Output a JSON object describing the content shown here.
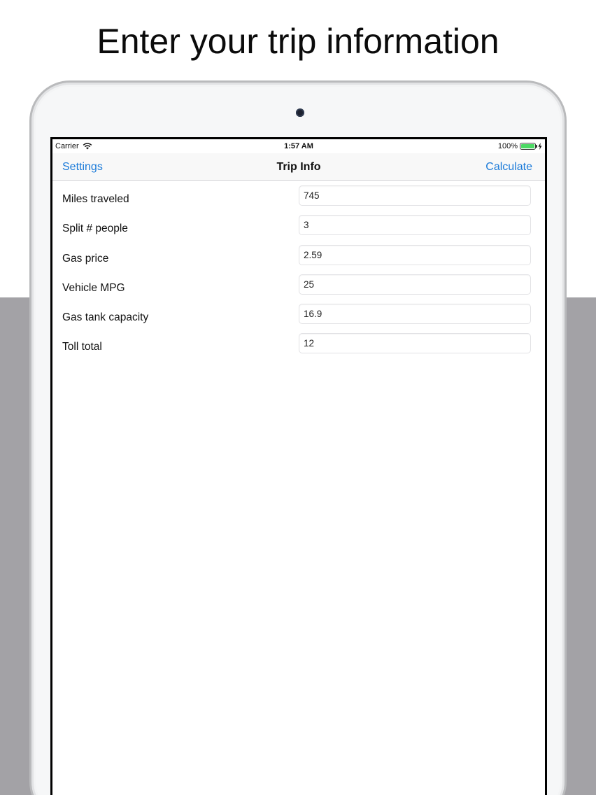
{
  "headline": "Enter your trip information",
  "status_bar": {
    "carrier": "Carrier",
    "time": "1:57 AM",
    "battery": "100%",
    "battery_level": 1.0,
    "battery_color": "#4cd964"
  },
  "nav": {
    "left": "Settings",
    "title": "Trip Info",
    "right": "Calculate",
    "tint_color": "#1c7bd9"
  },
  "fields": [
    {
      "label": "Miles traveled",
      "value": "745"
    },
    {
      "label": "Split # people",
      "value": "3"
    },
    {
      "label": "Gas price",
      "value": "2.59"
    },
    {
      "label": "Vehicle MPG",
      "value": "25"
    },
    {
      "label": "Gas tank capacity",
      "value": "16.9"
    },
    {
      "label": "Toll total",
      "value": "12"
    }
  ],
  "icons": {
    "wifi": "wifi-icon",
    "charging": "bolt-icon",
    "camera": "front-camera"
  }
}
